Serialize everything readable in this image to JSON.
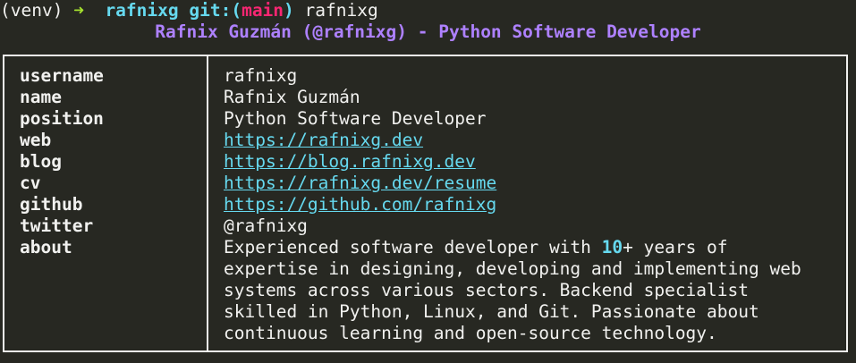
{
  "prompt": {
    "venv": "(venv)",
    "arrow": "➜",
    "directory": "rafnixg",
    "git_prefix": "git:(",
    "branch": "main",
    "git_suffix": ")",
    "command": "rafnixg"
  },
  "title": "Rafnix Guzmán (@rafnixg) - Python Software Developer",
  "profile": {
    "keys": [
      "username",
      "name",
      "position",
      "web",
      "blog",
      "cv",
      "github",
      "twitter",
      "about"
    ],
    "username": "rafnixg",
    "name": "Rafnix Guzmán",
    "position": "Python Software Developer",
    "web": "https://rafnixg.dev",
    "blog": "https://blog.rafnixg.dev",
    "cv": "https://rafnixg.dev/resume",
    "github": "https://github.com/rafnixg",
    "twitter": "@rafnixg",
    "about": {
      "line1_pre": "Experienced software developer with ",
      "line1_num": "10",
      "line1_post": "+ years of",
      "line2": "expertise in designing, developing and implementing web",
      "line3": "systems across various sectors. Backend specialist",
      "line4": "skilled in Python, Linux, and Git. Passionate about",
      "line5": "continuous learning and open-source technology."
    }
  },
  "colors": {
    "background": "#272822",
    "foreground": "#f1f1ef",
    "accent_green": "#a6e22e",
    "accent_cyan": "#66d9ef",
    "accent_pink": "#f92672",
    "accent_purple": "#ae81ff"
  }
}
